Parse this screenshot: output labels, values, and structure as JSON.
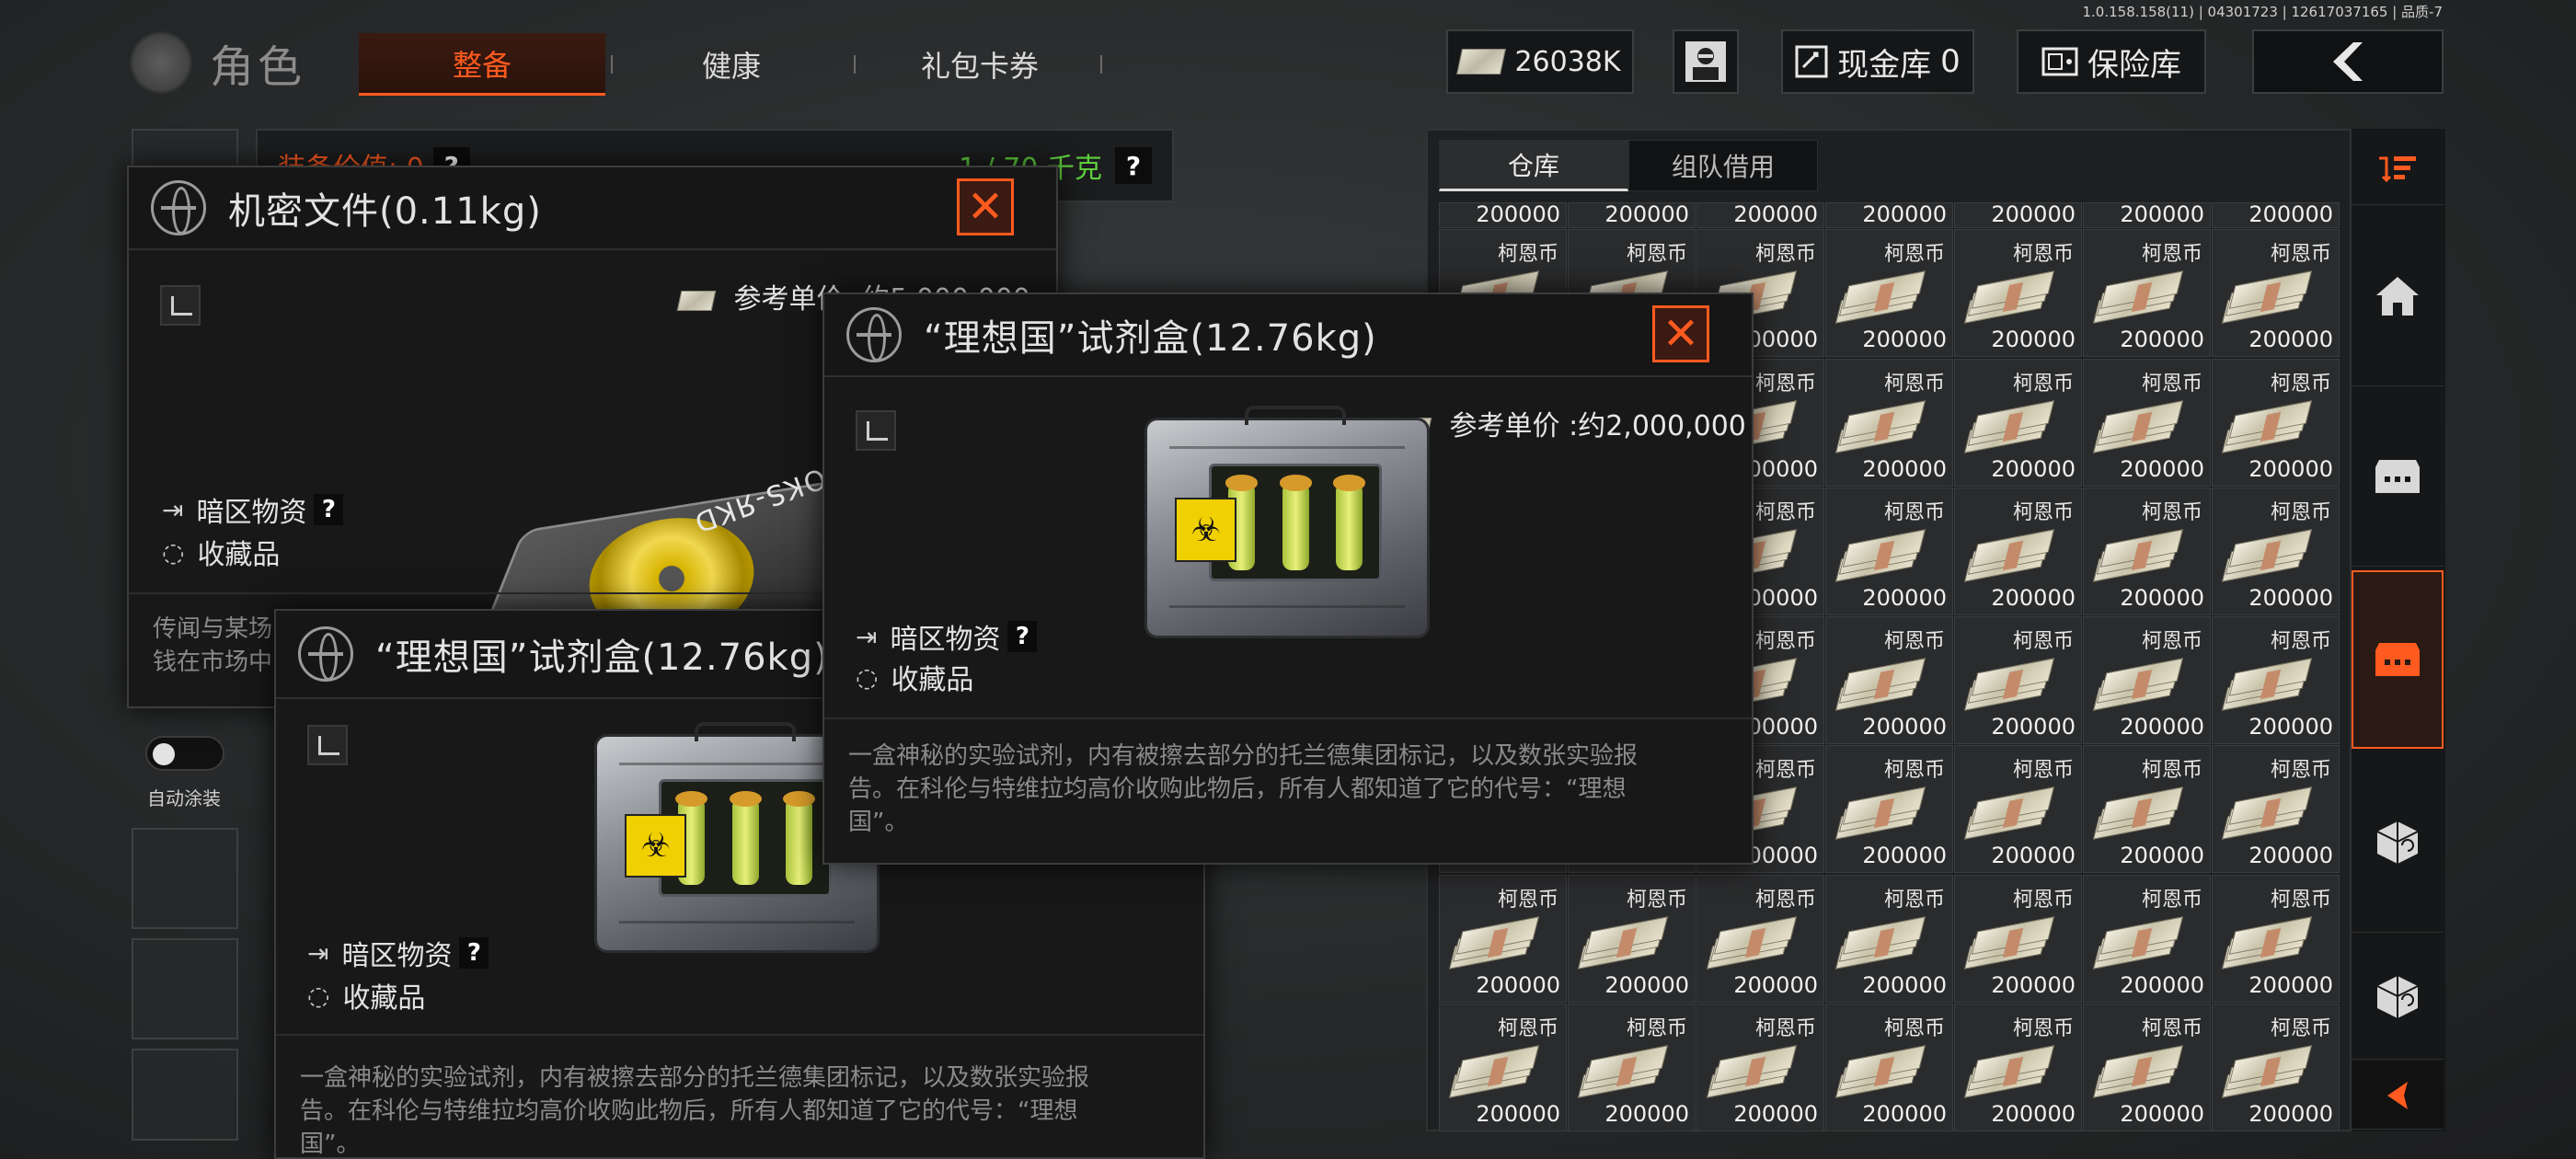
{
  "version": "1.0.158.158(11) | 04301723 | 12617037165 | 品质-7",
  "nav": {
    "title": "角色",
    "tabs": [
      "整备",
      "健康",
      "礼包卡券"
    ]
  },
  "top": {
    "cash": "26038K",
    "vault_label": "现金库",
    "vault_value": "0",
    "safe_label": "保险库"
  },
  "equip": {
    "value_label": "装备价值: 0",
    "weight": "1 / 70 千克",
    "help": "?"
  },
  "auto_paint": "自动涂装",
  "warehouse": {
    "tabs": [
      "仓库",
      "组队借用"
    ],
    "cell_name": "柯恩币",
    "cell_amount": "200000",
    "top_row": [
      "200000",
      "200000",
      "200000",
      "200000",
      "200000",
      "200000",
      "200000"
    ]
  },
  "popup_secret": {
    "title": "机密文件(0.11kg)",
    "ref_price": "参考单价 :约5,000,000",
    "disc_label": "OKS-ЯKD",
    "tag_zone": "暗区物资",
    "tag_collect": "收藏品",
    "desc_1": "传闻与某场",
    "desc_2": "钱在市场中"
  },
  "popup_back": {
    "title": "“理想国”试剂盒(12.76kg)",
    "tag_zone": "暗区物资",
    "tag_collect": "收藏品",
    "desc_1": "一盒神秘的实验试剂，内有被擦去部分的托兰德集团标记，以及数张实验报",
    "desc_2": "告。在科伦与特维拉均高价收购此物后，所有人都知道了它的代号：“理想",
    "desc_3": "国”。"
  },
  "popup_front": {
    "title": "“理想国”试剂盒(12.76kg)",
    "ref_price": "参考单价 :约2,000,000",
    "tag_zone": "暗区物资",
    "tag_collect": "收藏品",
    "desc_1": "一盒神秘的实验试剂，内有被擦去部分的托兰德集团标记，以及数张实验报",
    "desc_2": "告。在科伦与特维拉均高价收购此物后，所有人都知道了它的代号：“理想",
    "desc_3": "国”。"
  },
  "colors": {
    "accent": "#ff5a1f",
    "weight_green": "#5fd03e"
  }
}
